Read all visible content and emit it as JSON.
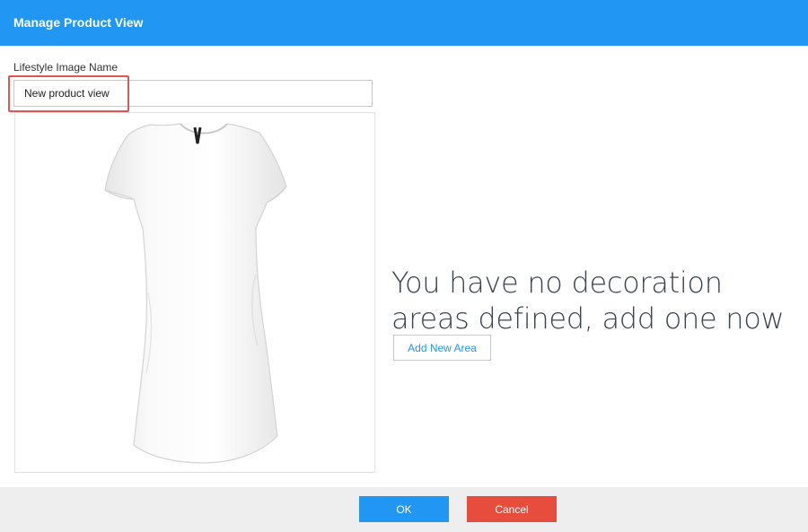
{
  "header": {
    "title": "Manage Product View"
  },
  "form": {
    "name_label": "Lifestyle Image Name",
    "name_value": "New product view"
  },
  "product_image": {
    "icon": "tshirt-dress-icon",
    "color": "#f4f4f4"
  },
  "empty_state": {
    "message": "You have no decoration areas defined, add one now",
    "add_button_label": "Add New Area"
  },
  "footer": {
    "ok_label": "OK",
    "cancel_label": "Cancel"
  },
  "colors": {
    "accent": "#2196f3",
    "danger": "#e74c3c",
    "highlight": "#e05555"
  }
}
